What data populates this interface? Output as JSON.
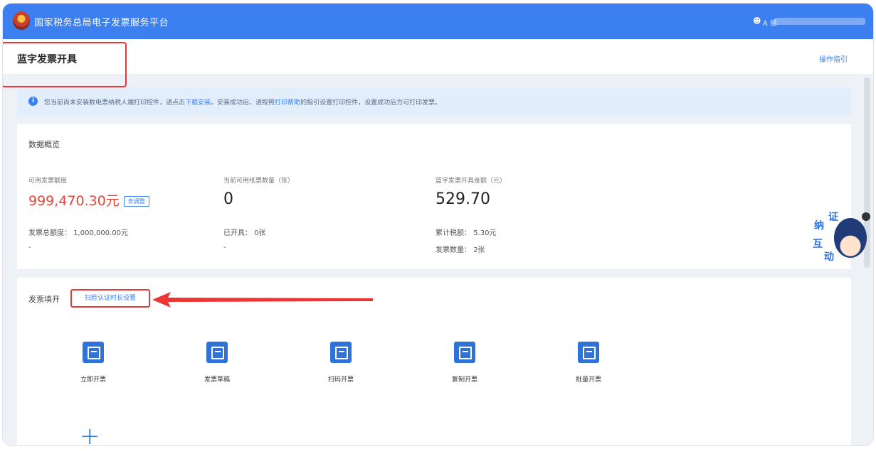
{
  "header": {
    "site_title": "国家税务总局电子发票服务平台",
    "user_prefix": "A 侯"
  },
  "page": {
    "title": "蓝字发票开具",
    "guide_link": "操作指引"
  },
  "notice": {
    "icon": "info-icon",
    "text_before": "您当前尚未安装数电票纳税人端打印控件，请点击",
    "link1": "下载安装",
    "text_middle": "。安装成功后，请按照",
    "link2": "打印帮助",
    "text_after": "的指引设置打印控件，设置成功后方可打印发票。"
  },
  "overview": {
    "title": "数据概览",
    "available_quota_label": "可用发票额度",
    "available_quota_value": "999,470.30元",
    "adjust_tag": "去调整",
    "total_quota_label": "发票总额度：",
    "total_quota_value": "1,000,000.00元",
    "paper_count_label": "当前可用纸票数量（张）",
    "paper_count_value": "0",
    "issued_label": "已开具：",
    "issued_value": "0张",
    "blue_amount_label": "蓝字发票开具金额（元）",
    "blue_amount_value": "529.70",
    "tax_label": "累计税额：",
    "tax_value": "5.30元",
    "invoice_count_label": "发票数量：",
    "invoice_count_value": "2张",
    "dash1": "-",
    "dash2": "-"
  },
  "issue": {
    "title": "发票填开",
    "scan_link": "扫脸认证时长设置",
    "tiles": [
      {
        "label": "立即开票",
        "icon": "invoice-icon"
      },
      {
        "label": "发票草稿",
        "icon": "draft-icon"
      },
      {
        "label": "扫码开票",
        "icon": "qr-icon"
      },
      {
        "label": "复制开票",
        "icon": "copy-icon"
      },
      {
        "label": "批量开票",
        "icon": "batch-icon"
      }
    ],
    "plus_icon": "+"
  },
  "mascot": {
    "chars": [
      "纳",
      "证",
      "互",
      "动"
    ]
  },
  "colors": {
    "brand": "#3b7ff0",
    "highlight": "#ec3636",
    "quota": "#e5463c"
  }
}
